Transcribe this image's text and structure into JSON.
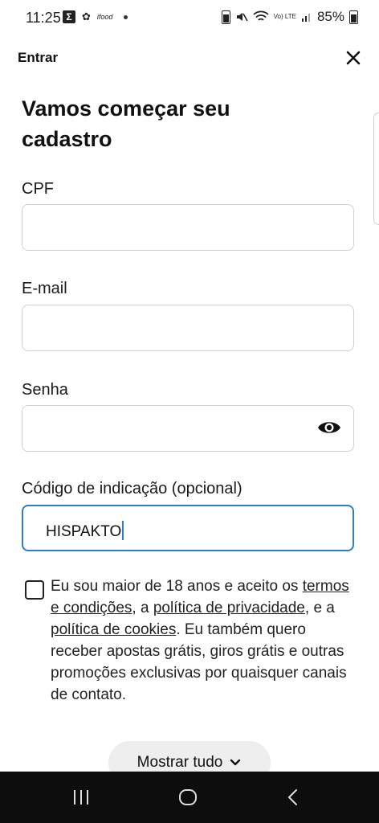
{
  "status_bar": {
    "time": "11:25",
    "left_small_1": "✿",
    "left_small_2": "ifood",
    "volte": "Vo) LTE",
    "battery": "85%"
  },
  "header": {
    "title": "Entrar",
    "close_icon": "close-icon"
  },
  "page": {
    "title": "Vamos começar seu cadastro"
  },
  "form": {
    "cpf": {
      "label": "CPF",
      "value": ""
    },
    "email": {
      "label": "E-mail",
      "value": ""
    },
    "password": {
      "label": "Senha",
      "value": "",
      "icon": "eye-icon"
    },
    "referral": {
      "label": "Código de indicação (opcional)",
      "value": "HISPAKTO"
    }
  },
  "consent": {
    "text_1": "Eu sou maior de 18 anos e aceito os ",
    "link_terms": "termos e condições",
    "text_2": ", a ",
    "link_privacy": "política de privacidade",
    "text_3": ", e a ",
    "link_cookies": "política de cookies",
    "text_4": ". Eu também quero receber apostas grátis, giros grátis e outras promoções exclusivas por quaisquer canais de contato."
  },
  "show_all": {
    "label": "Mostrar tudo"
  },
  "colors": {
    "accent": "#2a7fc9",
    "nav_bg": "#0d0d0d",
    "button_bg": "#eeeeee"
  }
}
